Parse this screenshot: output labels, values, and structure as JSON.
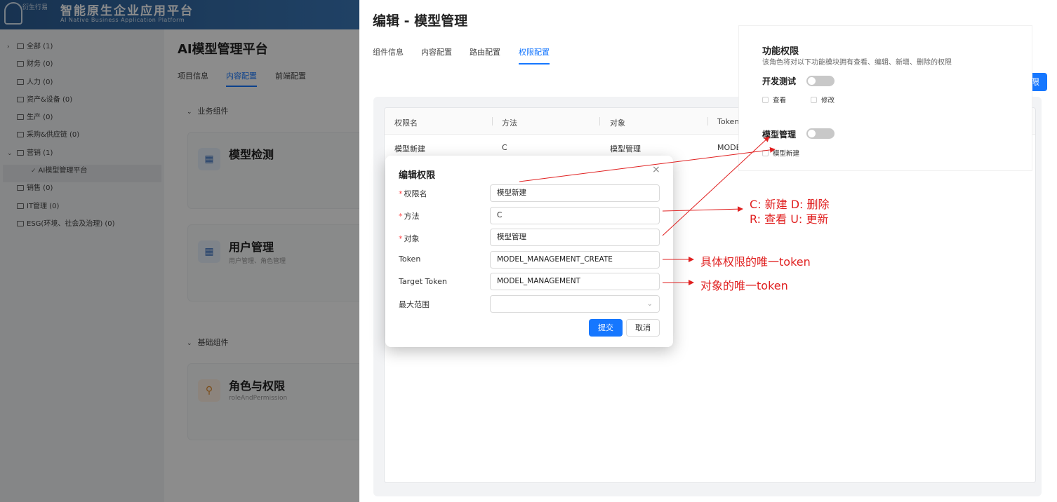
{
  "app": {
    "logo_text": "衍生行易",
    "title": "智能原生企业应用平台",
    "subtitle": "AI Native Business Application Platform"
  },
  "tree": {
    "items": [
      {
        "label": "全部 (1)",
        "caret": "›"
      },
      {
        "label": "财务 (0)"
      },
      {
        "label": "人力 (0)"
      },
      {
        "label": "资产&设备 (0)"
      },
      {
        "label": "生产 (0)"
      },
      {
        "label": "采购&供应链 (0)"
      },
      {
        "label": "营销 (1)",
        "caret": "⌄"
      },
      {
        "label": "AI模型管理平台",
        "child": true
      },
      {
        "label": "销售 (0)"
      },
      {
        "label": "IT管理 (0)"
      },
      {
        "label": "ESG(环境、社会及治理) (0)"
      }
    ]
  },
  "main": {
    "title": "AI模型管理平台",
    "tabs": [
      "项目信息",
      "内容配置",
      "前端配置"
    ],
    "sections": {
      "business": "业务组件",
      "basic": "基础组件"
    },
    "components": [
      {
        "name": "模型检测",
        "desc": ""
      },
      {
        "name": "用户管理",
        "desc": "用户管理、角色管理"
      },
      {
        "name": "角色与权限",
        "desc": "roleAndPermission"
      }
    ]
  },
  "drawer": {
    "title": "编辑 - 模型管理",
    "tabs": [
      "组件信息",
      "内容配置",
      "路由配置",
      "权限配置"
    ],
    "add_button": "限",
    "table": {
      "columns": [
        "权限名",
        "方法",
        "对象",
        "Token"
      ],
      "rows": [
        [
          "模型新建",
          "C",
          "模型管理",
          "MODE"
        ]
      ]
    }
  },
  "modal": {
    "title": "编辑权限",
    "close": "×",
    "fields": {
      "name": {
        "label": "权限名",
        "value": "模型新建",
        "required": true
      },
      "method": {
        "label": "方法",
        "value": "C",
        "required": true
      },
      "object": {
        "label": "对象",
        "value": "模型管理",
        "required": true
      },
      "token": {
        "label": "Token",
        "value": "MODEL_MANAGEMENT_CREATE"
      },
      "target_token": {
        "label": "Target Token",
        "value": "MODEL_MANAGEMENT"
      },
      "max_scope": {
        "label": "最大范围",
        "value": ""
      }
    },
    "submit": "提交",
    "cancel": "取消"
  },
  "function_permission": {
    "title": "功能权限",
    "desc": "该角色将对以下功能模块拥有查看、编辑、新增、删除的权限",
    "modules": [
      {
        "name": "开发测试",
        "checks": [
          "查看",
          "修改"
        ]
      },
      {
        "name": "模型管理",
        "checks": [
          "模型新建"
        ]
      }
    ]
  },
  "annotations": {
    "method_line1": "C: 新建 D:  删除",
    "method_line2": "R:  查看 U:  更新",
    "token_note": "具体权限的唯一token",
    "target_token_note": "对象的唯一token",
    "color": "#e02020"
  },
  "colors": {
    "primary": "#1677ff",
    "required": "#ff4d4f",
    "header": "#2c5d93"
  }
}
